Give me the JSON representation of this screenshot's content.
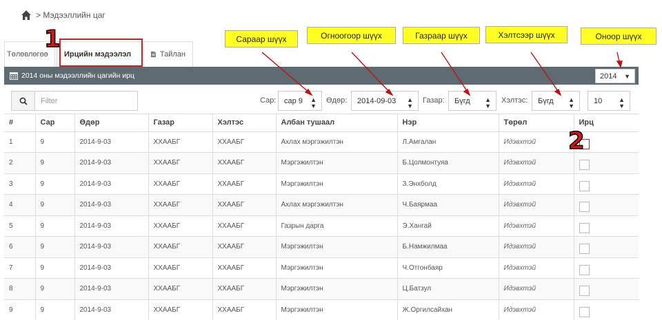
{
  "breadcrumb": {
    "home_icon": "home-icon",
    "text": "> Мэдээллийн цаг"
  },
  "tabs": [
    {
      "label": "Төлөвлөгөө",
      "active": false
    },
    {
      "label": "Ирцийн мэдээлэл",
      "active": true
    },
    {
      "label": "Тайлан",
      "active": false,
      "icon": "document-icon"
    }
  ],
  "panel": {
    "title": "2014 оны мэдээллийн цагийн ирц",
    "icon": "calendar-icon",
    "year": "2014"
  },
  "filters": {
    "search_placeholder": "Filter",
    "month_label": "Сар:",
    "month_value": "сар 9",
    "day_label": "Өдөр:",
    "day_value": "2014-09-03",
    "place_label": "Газар:",
    "place_value": "Бүгд",
    "dept_label": "Хэлтэс:",
    "dept_value": "Бүгд",
    "page_size": "10"
  },
  "table": {
    "headers": [
      "#",
      "Сар",
      "Өдөр",
      "Газар",
      "Хэлтэс",
      "Албан тушаал",
      "Нэр",
      "Төрөл",
      "Ирц"
    ],
    "rows": [
      [
        "1",
        "9",
        "2014-9-03",
        "ХХААБГ",
        "ХХААБГ",
        "Ахлах мэргэжилтэн",
        "Л.Амгалан",
        "Идэвхтэй"
      ],
      [
        "2",
        "9",
        "2014-9-03",
        "ХХААБГ",
        "ХХААБГ",
        "Мэргэжилтэн",
        "Б.Цолмонтуяа",
        "Идэвхтэй"
      ],
      [
        "3",
        "9",
        "2014-9-03",
        "ХХААБГ",
        "ХХААБГ",
        "Мэргэжилтэн",
        "З.Энхболд",
        "Идэвхтэй"
      ],
      [
        "4",
        "9",
        "2014-9-03",
        "ХХААБГ",
        "ХХААБГ",
        "Ахлах мэргэжилтэн",
        "Ч.Баярмаа",
        "Идэвхтэй"
      ],
      [
        "5",
        "9",
        "2014-9-03",
        "ХХААБГ",
        "ХХААБГ",
        "Газрын дарга",
        "Э.Хангай",
        "Идэвхтэй"
      ],
      [
        "6",
        "9",
        "2014-9-03",
        "ХХААБГ",
        "ХХААБГ",
        "Мэргэжилтэн",
        "Б.Намжилмаа",
        "Идэвхтэй"
      ],
      [
        "7",
        "9",
        "2014-9-03",
        "ХХААБГ",
        "ХХААБГ",
        "Мэргэжилтэн",
        "Ч.Отгонбаяр",
        "Идэвхтэй"
      ],
      [
        "8",
        "9",
        "2014-9-03",
        "ХХААБГ",
        "ХХААБГ",
        "Мэргэжилтэн",
        "Ц.Батзул",
        "Идэвхтэй"
      ],
      [
        "9",
        "9",
        "2014-9-03",
        "ХХААБГ",
        "ХХААБГ",
        "Мэргэжилтэн",
        "Ж.Оргилсайхан",
        "Идэвхтэй"
      ]
    ]
  },
  "annotations": {
    "callouts": [
      "Сараар шүүх",
      "Огноогоор шүүх",
      "Газраар шүүх",
      "Хэлтсээр шүүх",
      "Оноор шүүх"
    ],
    "num1": "1",
    "num2": "2"
  },
  "colors": {
    "header_bar": "#5f6b73",
    "callout_bg": "#ffff22",
    "annotation_red": "#d01818"
  }
}
